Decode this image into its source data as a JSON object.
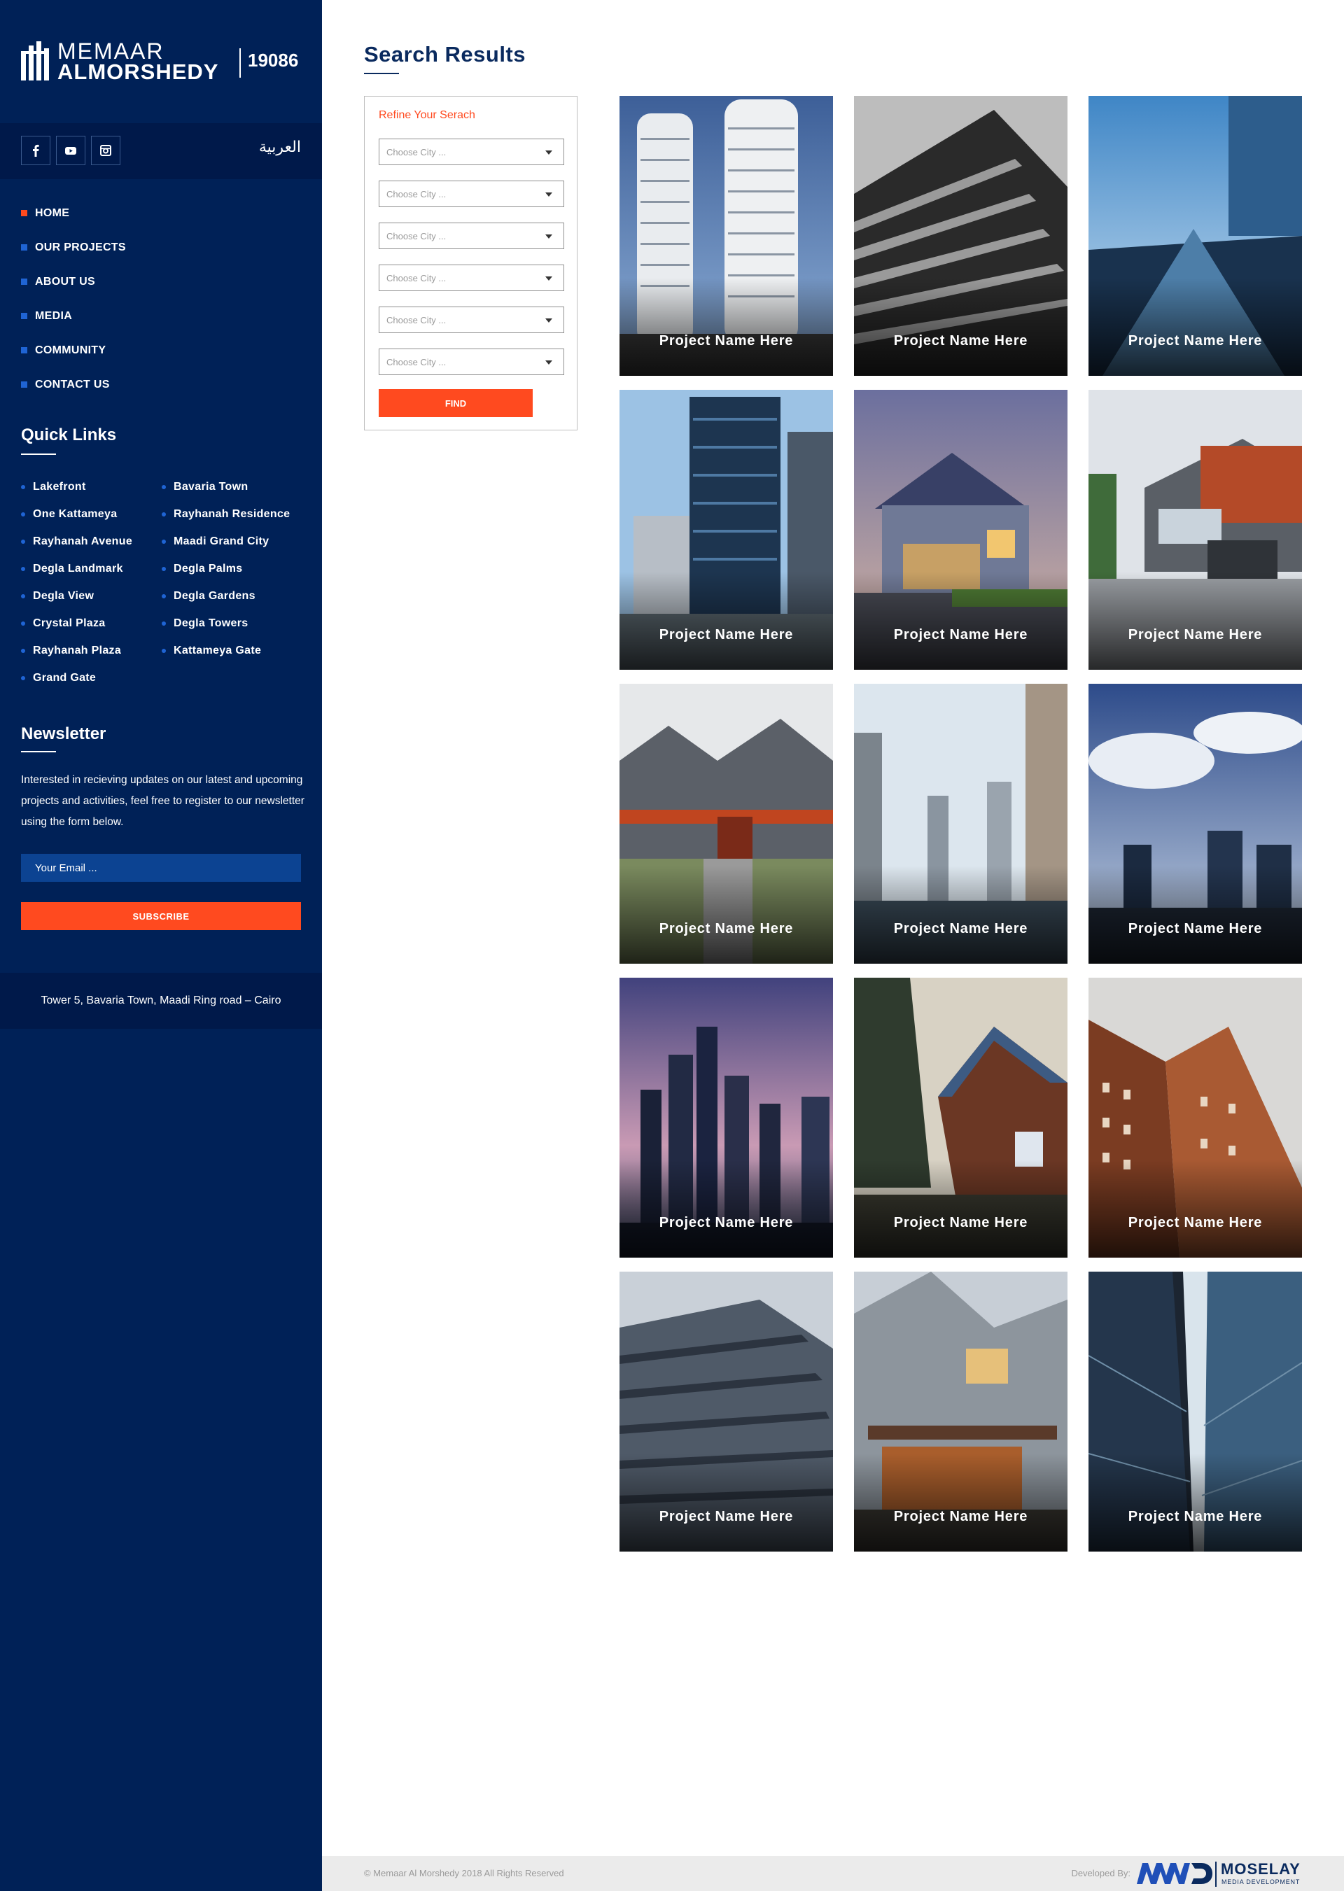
{
  "brand": {
    "name_line1": "MEMAAR",
    "name_line2": "ALMORSHEDY",
    "hotline": "19086"
  },
  "social": {
    "icons": [
      "facebook-icon",
      "youtube-icon",
      "instagram-icon"
    ],
    "language_link": "العربية"
  },
  "nav": {
    "items": [
      {
        "label": "HOME",
        "active": true
      },
      {
        "label": "OUR PROJECTS",
        "active": false
      },
      {
        "label": "ABOUT US",
        "active": false
      },
      {
        "label": "MEDIA",
        "active": false
      },
      {
        "label": "COMMUNITY",
        "active": false
      },
      {
        "label": "CONTACT US",
        "active": false
      }
    ]
  },
  "quick_links": {
    "title": "Quick Links",
    "col1": [
      "Lakefront",
      "One Kattameya",
      "Rayhanah Avenue",
      "Degla Landmark",
      "Degla View",
      "Crystal Plaza",
      "Rayhanah Plaza",
      "Grand Gate"
    ],
    "col2": [
      "Bavaria Town",
      "Rayhanah Residence",
      "Maadi Grand City",
      "Degla Palms",
      "Degla Gardens",
      "Degla Towers",
      "Kattameya Gate"
    ]
  },
  "newsletter": {
    "title": "Newsletter",
    "description": "Interested in recieving updates on our latest and upcoming projects and activities, feel free to register to our newsletter using the form below.",
    "email_placeholder": "Your Email ...",
    "subscribe_label": "SUBSCRIBE"
  },
  "address": "Tower 5,  Bavaria Town, Maadi Ring road – Cairo",
  "main": {
    "title": "Search Results",
    "refine": {
      "title": "Refine Your Serach",
      "selects": [
        "Choose City ...",
        "Choose City ...",
        "Choose City ...",
        "Choose City ...",
        "Choose City ...",
        "Choose City ..."
      ],
      "find_label": "FIND"
    },
    "projects": [
      {
        "label": "Project Name Here"
      },
      {
        "label": "Project Name Here"
      },
      {
        "label": "Project Name Here"
      },
      {
        "label": "Project Name Here"
      },
      {
        "label": "Project Name Here"
      },
      {
        "label": "Project Name Here"
      },
      {
        "label": "Project Name Here"
      },
      {
        "label": "Project Name Here"
      },
      {
        "label": "Project Name Here"
      },
      {
        "label": "Project Name Here"
      },
      {
        "label": "Project Name Here"
      },
      {
        "label": "Project Name Here"
      },
      {
        "label": "Project Name Here"
      },
      {
        "label": "Project Name Here"
      },
      {
        "label": "Project Name Here"
      }
    ]
  },
  "footer": {
    "copyright": "© Memaar Al Morshedy 2018 All Rights Reserved",
    "developed_by": "Developed By:",
    "developer_name": "MOSELAY",
    "developer_tagline": "MEDIA DEVELOPMENT"
  },
  "colors": {
    "sidebar_bg": "#002157",
    "sidebar_dark": "#00194a",
    "accent": "#ff4a1f",
    "bullet_blue": "#1f64d4",
    "title_navy": "#0a2a5e"
  }
}
